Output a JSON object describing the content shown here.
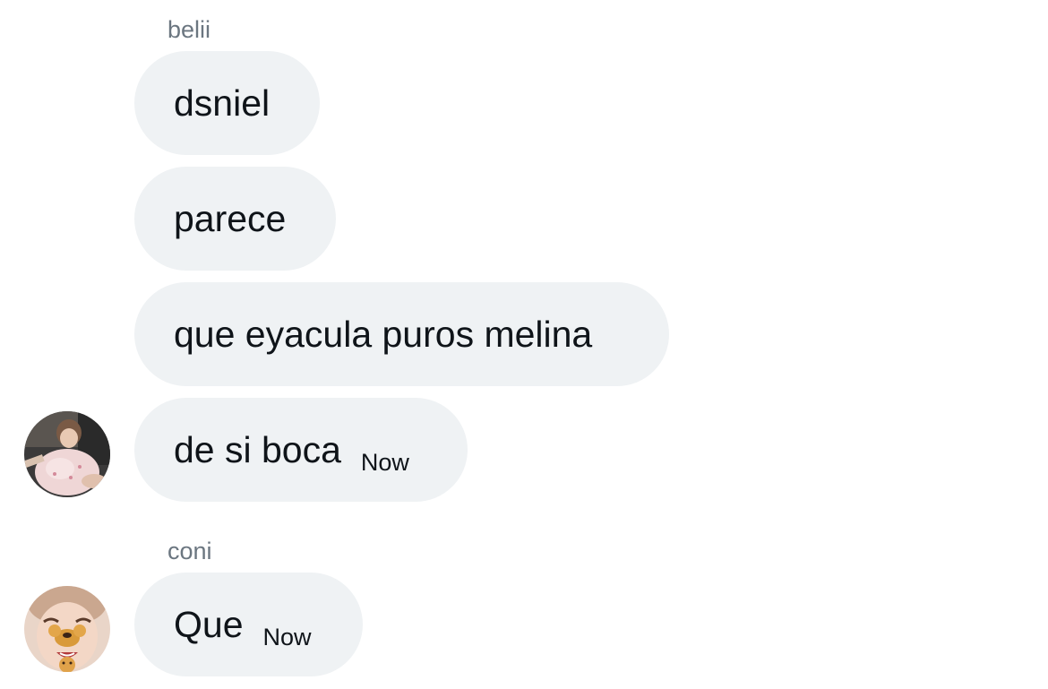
{
  "groups": [
    {
      "sender": "belii",
      "avatar_icon": "user-photo-avatar",
      "messages": [
        {
          "text": "dsniel"
        },
        {
          "text": "parece"
        },
        {
          "text": "que eyacula puros melina"
        },
        {
          "text": "de si boca",
          "time": "Now"
        }
      ]
    },
    {
      "sender": "coni",
      "avatar_icon": "user-photo-avatar",
      "messages": [
        {
          "text": "Que",
          "time": "Now"
        }
      ]
    }
  ],
  "colors": {
    "bubble_bg": "#eff2f4",
    "text": "#0f1419",
    "sender_name": "#6b7680",
    "background": "#ffffff"
  }
}
